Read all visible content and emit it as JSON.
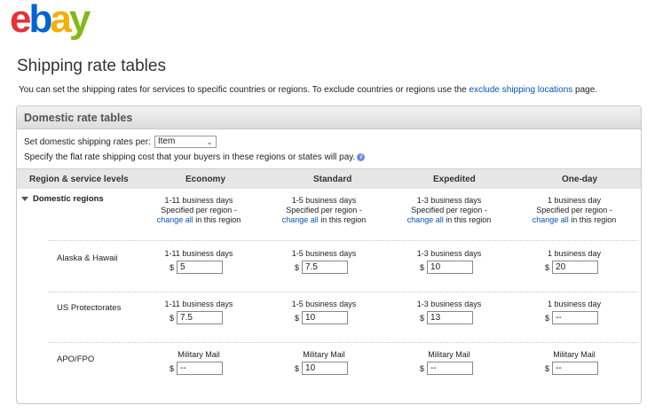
{
  "logo": {
    "e": "e",
    "b": "b",
    "a": "a",
    "y": "y"
  },
  "page_title": "Shipping rate tables",
  "intro": {
    "text": "You can set the shipping rates for services to specific countries or regions. To exclude countries or regions use the",
    "link": "exclude shipping locations",
    "after": "page."
  },
  "panel": {
    "title": "Domestic rate tables",
    "per_label": "Set domestic shipping rates per:",
    "per_value": "Item",
    "specify": "Specify the flat rate shipping cost that your buyers in these regions or states will pay."
  },
  "columns": {
    "region": "Region & service levels",
    "economy": "Economy",
    "standard": "Standard",
    "expedited": "Expedited",
    "oneday": "One-day"
  },
  "domestic": {
    "label": "Domestic regions",
    "specified": "Specified per region -",
    "change_all": "change all",
    "in_region": "in this region",
    "economy_days": "1-11 business days",
    "standard_days": "1-5 business days",
    "expedited_days": "1-3 business days",
    "oneday_days": "1 business day"
  },
  "currency": "$",
  "rows": [
    {
      "name": "Alaska & Hawaii",
      "titles": [
        "1-11 business days",
        "1-5 business days",
        "1-3 business days",
        "1 business day"
      ],
      "values": [
        "5",
        "7.5",
        "10",
        "20"
      ]
    },
    {
      "name": "US Protectorates",
      "titles": [
        "1-11 business days",
        "1-5 business days",
        "1-3 business days",
        "1 business day"
      ],
      "values": [
        "7.5",
        "10",
        "13",
        "--"
      ]
    },
    {
      "name": "APO/FPO",
      "titles": [
        "Military Mail",
        "Military Mail",
        "Military Mail",
        "Military Mail"
      ],
      "values": [
        "--",
        "10",
        "--",
        "--"
      ]
    }
  ]
}
